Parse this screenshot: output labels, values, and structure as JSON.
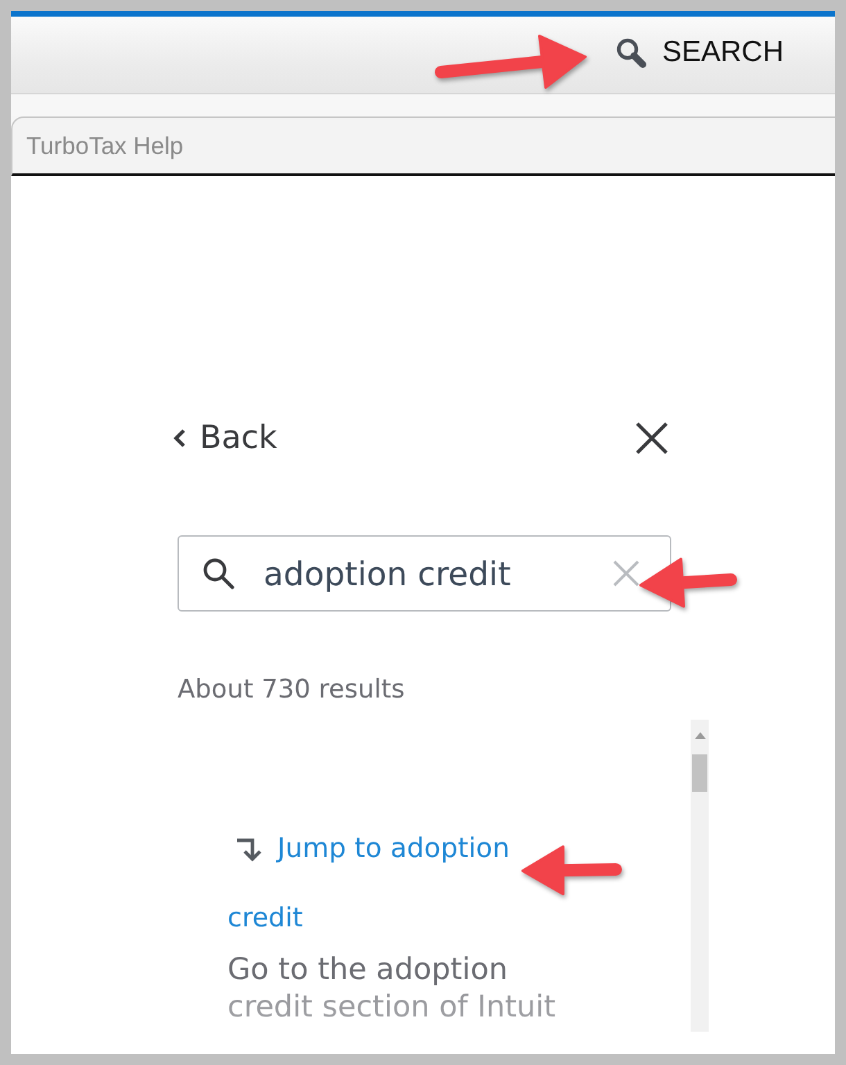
{
  "header": {
    "search_button": "SEARCH"
  },
  "help_panel": {
    "title": "TurboTax Help"
  },
  "search_pane": {
    "back_button": "Back",
    "search_field": {
      "value": "adoption credit"
    },
    "result_count": "About 730 results",
    "results": [
      {
        "jump_link": "Jump to adoption",
        "title": "credit",
        "snippet": "Go to the adoption credit section of Intuit"
      }
    ]
  }
}
